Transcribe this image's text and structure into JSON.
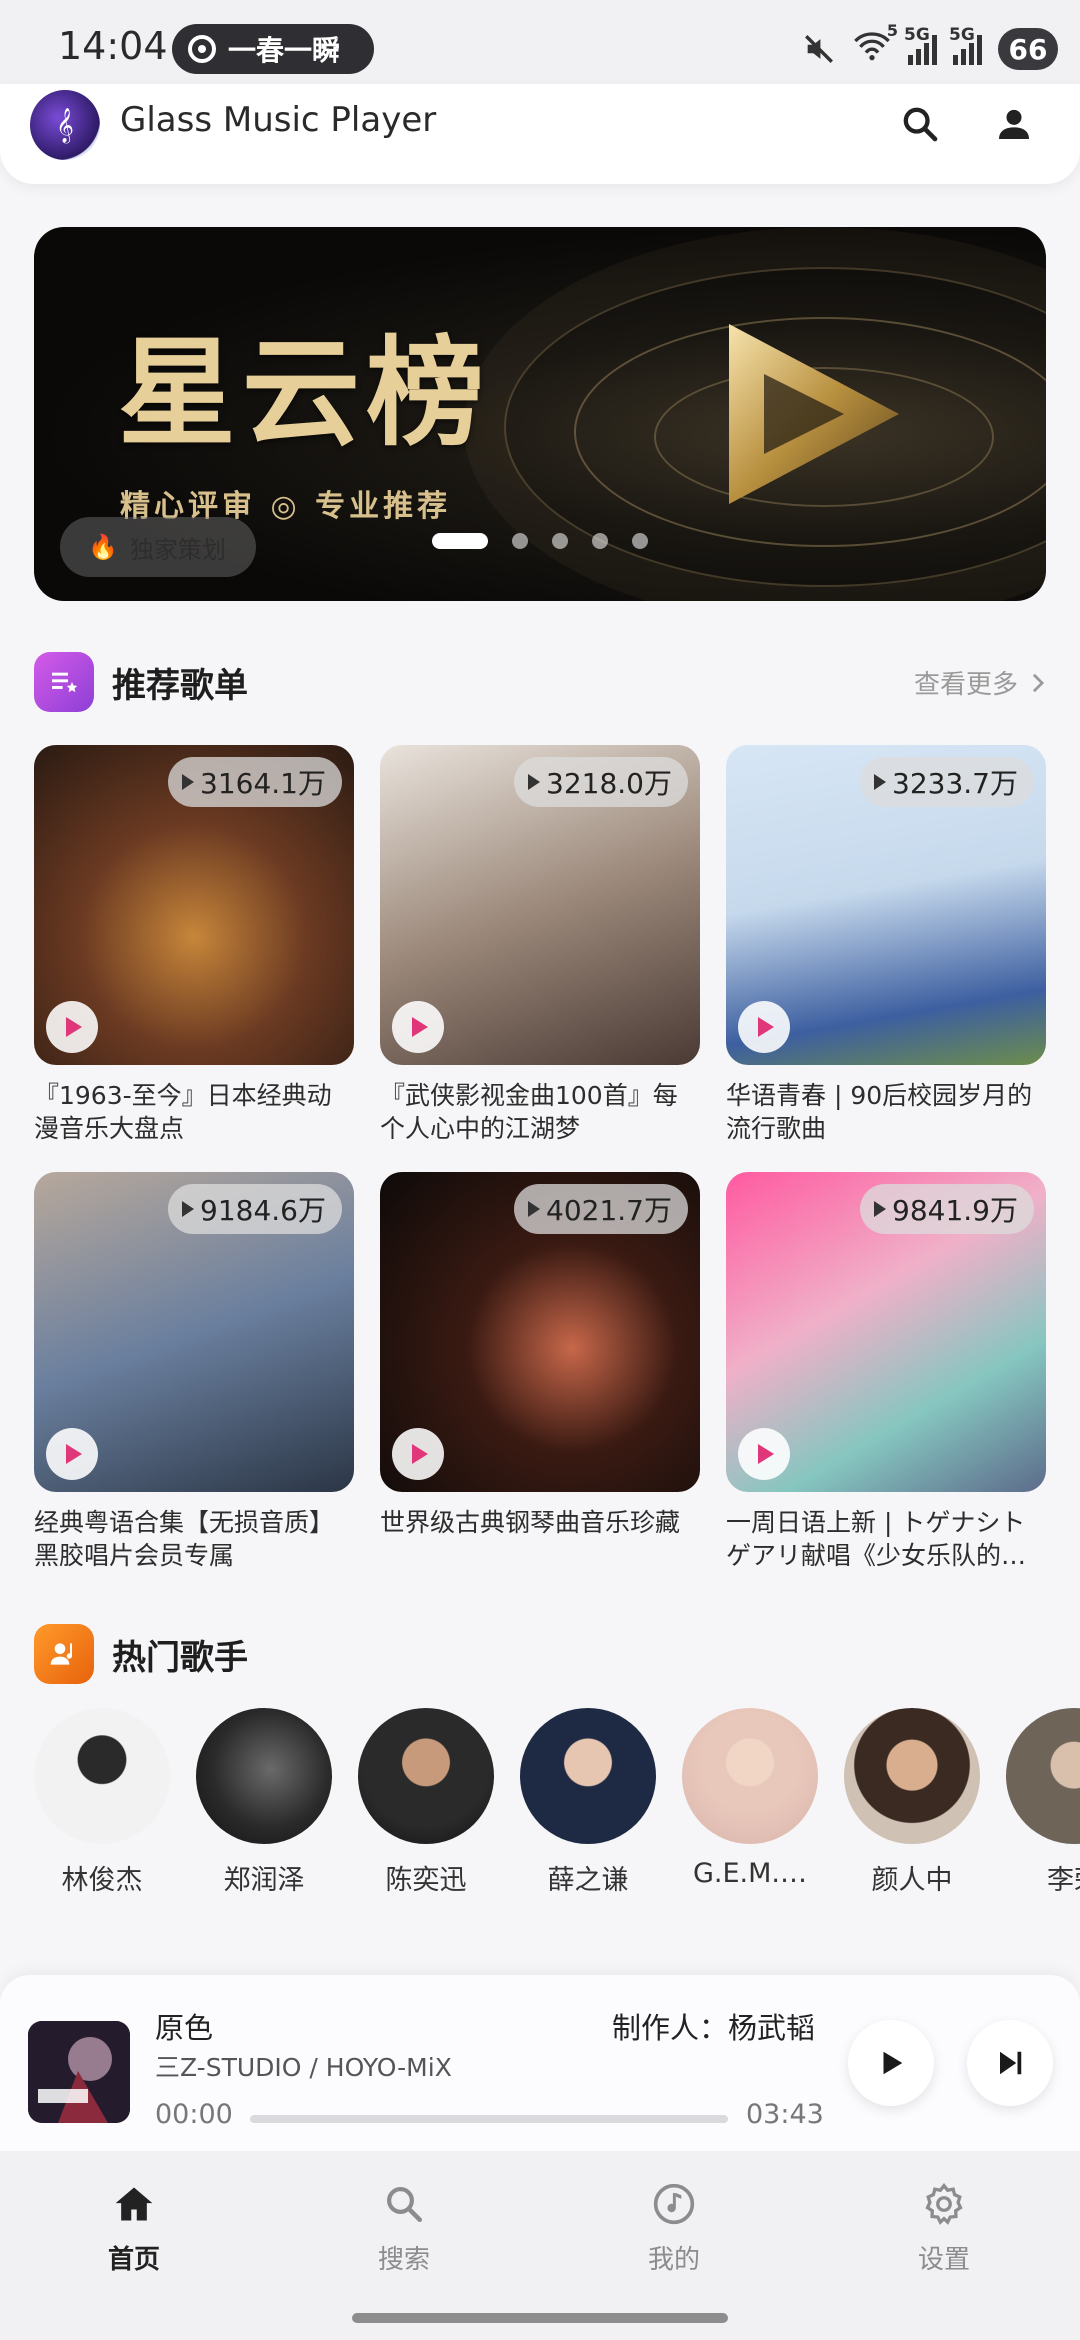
{
  "status_bar": {
    "time": "14:04",
    "pill_text": "一春一瞬",
    "wifi_badge": "5",
    "signal1_label": "5G",
    "signal2_label": "5G",
    "battery": "66",
    "icons": [
      "mute-icon",
      "wifi-icon",
      "signal-icon",
      "signal-icon",
      "battery-icon"
    ]
  },
  "header": {
    "title": "Glass Music Player",
    "icons": [
      "search-icon",
      "account-icon"
    ]
  },
  "banner": {
    "title": "星云榜",
    "subtitle": "精心评审 ◎ 专业推荐",
    "tag": "独家策划",
    "slide_count": 5,
    "active_slide": 0
  },
  "recommended": {
    "title": "推荐歌单",
    "see_more": "查看更多",
    "playlists": [
      {
        "title": "『1963-至今』日本经典动漫音乐大盘点",
        "plays": "3164.1万"
      },
      {
        "title": "『武侠影视金曲100首』每个人心中的江湖梦",
        "plays": "3218.0万"
      },
      {
        "title": "华语青春 | 90后校园岁月的流行歌曲",
        "plays": "3233.7万"
      },
      {
        "title": "经典粤语合集【无损音质】黑胶唱片会员专属",
        "plays": "9184.6万"
      },
      {
        "title": "世界级古典钢琴曲音乐珍藏",
        "plays": "4021.7万"
      },
      {
        "title": "一周日语上新 | トゲナシトゲアリ献唱《少女乐队的…",
        "plays": "9841.9万"
      }
    ]
  },
  "artists": {
    "title": "热门歌手",
    "items": [
      {
        "name": "林俊杰"
      },
      {
        "name": "郑润泽"
      },
      {
        "name": "陈奕迅"
      },
      {
        "name": "薛之谦"
      },
      {
        "name": "G.E.M.…"
      },
      {
        "name": "颜人中"
      },
      {
        "name": "李荣"
      }
    ]
  },
  "player": {
    "song": "原色",
    "producer": "制作人：杨武韬",
    "artist": "三Z-STUDIO / HOYO-MiX",
    "current_time": "00:00",
    "total_time": "03:43",
    "progress": 0
  },
  "nav": {
    "items": [
      {
        "label": "首页",
        "icon": "home-icon",
        "active": true
      },
      {
        "label": "搜索",
        "icon": "search-icon",
        "active": false
      },
      {
        "label": "我的",
        "icon": "music-note-icon",
        "active": false
      },
      {
        "label": "设置",
        "icon": "settings-icon",
        "active": false
      }
    ]
  },
  "colors": {
    "accent_pink": "#e0367a",
    "playlist_section_icon": "#b04be0",
    "artist_section_icon": "#f07a1a"
  }
}
